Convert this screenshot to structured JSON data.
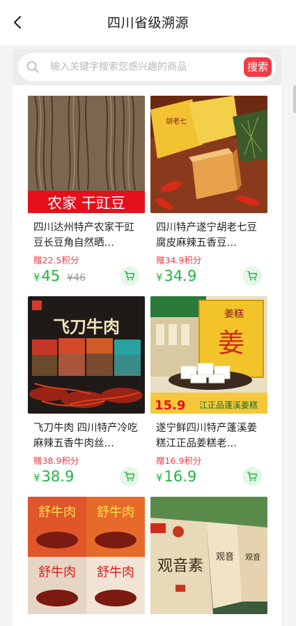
{
  "header": {
    "title": "四川省级溯源",
    "back_icon": "back-arrow-icon"
  },
  "search": {
    "placeholder": "输入关键字搜索您感兴趣的商品",
    "button_label": "搜索"
  },
  "colors": {
    "accent_red": "#f23b46",
    "price_green": "#21b540",
    "cart_bg": "#e6f7e9"
  },
  "products": [
    {
      "name": "四川达州特产农家干豇豆长豆角自然晒…",
      "points": "赠22.5积分",
      "currency": "¥",
      "price": "45",
      "original_price": "¥46",
      "image_text": "农家  干豇豆"
    },
    {
      "name": "四川特产遂宁胡老七豆腐皮麻辣五香豆…",
      "points": "赠34.9积分",
      "currency": "¥",
      "price": "34.9",
      "original_price": "",
      "image_text": ""
    },
    {
      "name": "飞刀牛肉 四川特产冷吃麻辣五香牛肉丝…",
      "points": "赠38.9积分",
      "currency": "¥",
      "price": "38.9",
      "original_price": "",
      "image_text": "飞刀牛肉"
    },
    {
      "name": "遂宁鲜四川特产蓬溪姜糕江正品姜糕老…",
      "points": "赠16.9积分",
      "currency": "¥",
      "price": "16.9",
      "original_price": "",
      "image_text": "江正品蓬溪姜糕"
    },
    {
      "name": "",
      "points": "",
      "currency": "",
      "price": "",
      "original_price": "",
      "image_text": ""
    },
    {
      "name": "",
      "points": "",
      "currency": "",
      "price": "",
      "original_price": "",
      "image_text": "观音素"
    }
  ]
}
